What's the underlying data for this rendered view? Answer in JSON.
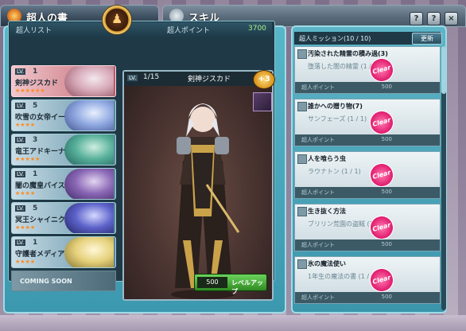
{
  "titlebar_left": {
    "title": "超人の書"
  },
  "titlebar_right": {
    "title": "スキル",
    "buttons": [
      "?",
      "?",
      "×"
    ]
  },
  "main": {
    "list_header": "超人リスト",
    "points_label": "超人ポイント",
    "points_value": "3700",
    "items": [
      {
        "lv_tag": "LV.",
        "level": "1",
        "name": "剣神ジスカド",
        "stars": "★★★★★★"
      },
      {
        "lv_tag": "LV.",
        "level": "5",
        "name": "吹雪の女帝イー",
        "stars": "★★★★"
      },
      {
        "lv_tag": "LV.",
        "level": "3",
        "name": "竜王アドキーナ",
        "stars": "★★★★★"
      },
      {
        "lv_tag": "LV.",
        "level": "1",
        "name": "闇の魔皇バイス",
        "stars": "★★★★"
      },
      {
        "lv_tag": "LV.",
        "level": "5",
        "name": "冥王シャイニク",
        "stars": "★★★★"
      },
      {
        "lv_tag": "LV.",
        "level": "1",
        "name": "守護者メディア",
        "stars": "★★★★"
      }
    ],
    "coming_soon": "COMING SOON",
    "detail": {
      "lv_tag": "LV.",
      "level": "1/15",
      "name": "剣神ジスカド",
      "badge": "+3",
      "upgrade_points": "500",
      "upgrade_label": "レベルアップ"
    }
  },
  "missions": {
    "header": "超人ミッション(10 / 10)",
    "refresh": "更新",
    "clear_label": "Clear",
    "items": [
      {
        "title": "汚染された精霊の積み過(3)",
        "desc": "堕落した闇の精霊 (1 / 1)",
        "bar_label": "超人ポイント",
        "bar_value": "500"
      },
      {
        "title": "誰かへの贈り物(7)",
        "desc": "サンフェーズ (1 / 1)",
        "bar_label": "超人ポイント",
        "bar_value": "500"
      },
      {
        "title": "人を喰らう虫",
        "desc": "ラウナトン (1 / 1)",
        "bar_label": "超人ポイント",
        "bar_value": "500"
      },
      {
        "title": "生き抜く方法",
        "desc": "ブリリン荒園の盗賊 (1 / 1)",
        "bar_label": "超人ポイント",
        "bar_value": "500"
      },
      {
        "title": "氷の魔法使い",
        "desc": "1年生の魔法の書 (1 / 1)",
        "bar_label": "超人ポイント",
        "bar_value": "500"
      }
    ]
  }
}
